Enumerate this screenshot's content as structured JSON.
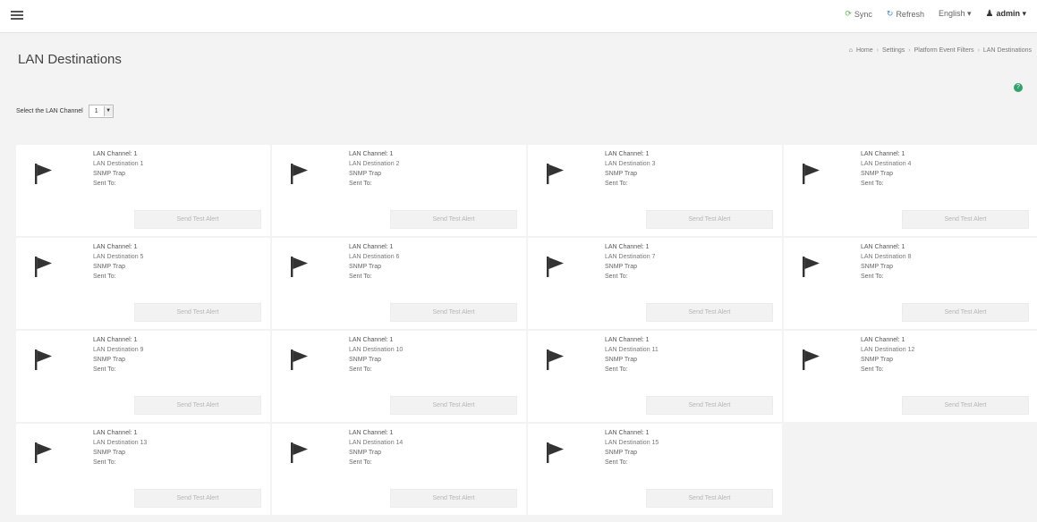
{
  "topbar": {
    "sync_label": "Sync",
    "refresh_label": "Refresh",
    "language_label": "English ▾",
    "user_label": "admin ▾"
  },
  "page": {
    "title": "LAN Destinations",
    "breadcrumb": [
      "Home",
      "Settings",
      "Platform Event Filters",
      "LAN Destinations"
    ]
  },
  "channel_selector": {
    "label": "Select the LAN Channel",
    "value": "1"
  },
  "cards": [
    {
      "channel": "LAN Channel: 1",
      "destination": "LAN Destination 1",
      "type": "SNMP Trap",
      "sent_to": "Sent To:",
      "button": "Send Test Alert"
    },
    {
      "channel": "LAN Channel: 1",
      "destination": "LAN Destination 2",
      "type": "SNMP Trap",
      "sent_to": "Sent To:",
      "button": "Send Test Alert"
    },
    {
      "channel": "LAN Channel: 1",
      "destination": "LAN Destination 3",
      "type": "SNMP Trap",
      "sent_to": "Sent To:",
      "button": "Send Test Alert"
    },
    {
      "channel": "LAN Channel: 1",
      "destination": "LAN Destination 4",
      "type": "SNMP Trap",
      "sent_to": "Sent To:",
      "button": "Send Test Alert"
    },
    {
      "channel": "LAN Channel: 1",
      "destination": "LAN Destination 5",
      "type": "SNMP Trap",
      "sent_to": "Sent To:",
      "button": "Send Test Alert"
    },
    {
      "channel": "LAN Channel: 1",
      "destination": "LAN Destination 6",
      "type": "SNMP Trap",
      "sent_to": "Sent To:",
      "button": "Send Test Alert"
    },
    {
      "channel": "LAN Channel: 1",
      "destination": "LAN Destination 7",
      "type": "SNMP Trap",
      "sent_to": "Sent To:",
      "button": "Send Test Alert"
    },
    {
      "channel": "LAN Channel: 1",
      "destination": "LAN Destination 8",
      "type": "SNMP Trap",
      "sent_to": "Sent To:",
      "button": "Send Test Alert"
    },
    {
      "channel": "LAN Channel: 1",
      "destination": "LAN Destination 9",
      "type": "SNMP Trap",
      "sent_to": "Sent To:",
      "button": "Send Test Alert"
    },
    {
      "channel": "LAN Channel: 1",
      "destination": "LAN Destination 10",
      "type": "SNMP Trap",
      "sent_to": "Sent To:",
      "button": "Send Test Alert"
    },
    {
      "channel": "LAN Channel: 1",
      "destination": "LAN Destination 11",
      "type": "SNMP Trap",
      "sent_to": "Sent To:",
      "button": "Send Test Alert"
    },
    {
      "channel": "LAN Channel: 1",
      "destination": "LAN Destination 12",
      "type": "SNMP Trap",
      "sent_to": "Sent To:",
      "button": "Send Test Alert"
    },
    {
      "channel": "LAN Channel: 1",
      "destination": "LAN Destination 13",
      "type": "SNMP Trap",
      "sent_to": "Sent To:",
      "button": "Send Test Alert"
    },
    {
      "channel": "LAN Channel: 1",
      "destination": "LAN Destination 14",
      "type": "SNMP Trap",
      "sent_to": "Sent To:",
      "button": "Send Test Alert"
    },
    {
      "channel": "LAN Channel: 1",
      "destination": "LAN Destination 15",
      "type": "SNMP Trap",
      "sent_to": "Sent To:",
      "button": "Send Test Alert"
    }
  ],
  "icons": {
    "menu": "hamburger-menu-icon",
    "sync": "sync-icon",
    "refresh": "refresh-icon",
    "user": "user-icon",
    "home": "home-icon",
    "help": "help-icon",
    "destination": "flag-icon"
  },
  "colors": {
    "sync_icon": "#5cb85c",
    "refresh_icon": "#3c8dbc",
    "help_icon": "#2fa36b",
    "flag": "#333333"
  }
}
